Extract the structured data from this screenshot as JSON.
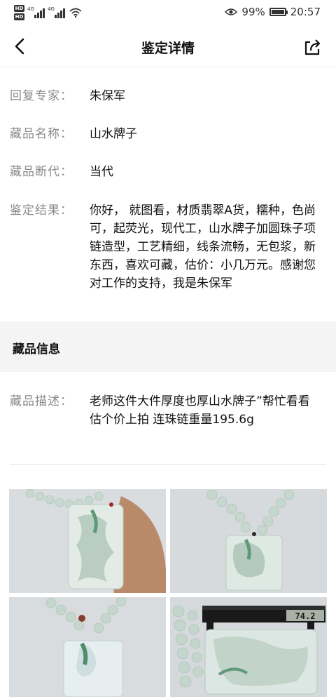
{
  "status_bar": {
    "hd1": "HD 1",
    "hd2": "HD 2",
    "net1": "4G",
    "net2": "4G",
    "battery": "99%",
    "time": "20:57"
  },
  "header": {
    "title": "鉴定详情"
  },
  "details": [
    {
      "label": "回复专家：",
      "value": "朱保军"
    },
    {
      "label": "藏品名称：",
      "value": "山水牌子"
    },
    {
      "label": "藏品断代：",
      "value": "当代"
    },
    {
      "label": "鉴定结果：",
      "value": "你好， 就图看，材质翡翠A货，糯种，色尚可，起荧光，现代工，山水牌子加圆珠子项链造型，工艺精细，线条流畅，无包浆，新东西，喜欢可藏，估价：小几万元。感谢您对工作的支持，我是朱保军"
    }
  ],
  "collection_info": {
    "section_title": "藏品信息",
    "desc_label": "藏品描述：",
    "desc_value": "老师这件大件厚度也厚山水牌子”帮忙看看估个价上拍 连珠链重量195.6g"
  },
  "photos": [
    {
      "alt": "jade-pendant-in-hand"
    },
    {
      "alt": "jade-pendant-on-necklace"
    },
    {
      "alt": "jade-pendant-bottom"
    },
    {
      "alt": "jade-pendant-caliper"
    }
  ],
  "caliper_reading": "74.2",
  "colors": {
    "label_gray": "#8a8a8a",
    "section_bg": "#f4f4f4",
    "jade_light": "#cfe0dc",
    "jade_green": "#5f9a78"
  }
}
